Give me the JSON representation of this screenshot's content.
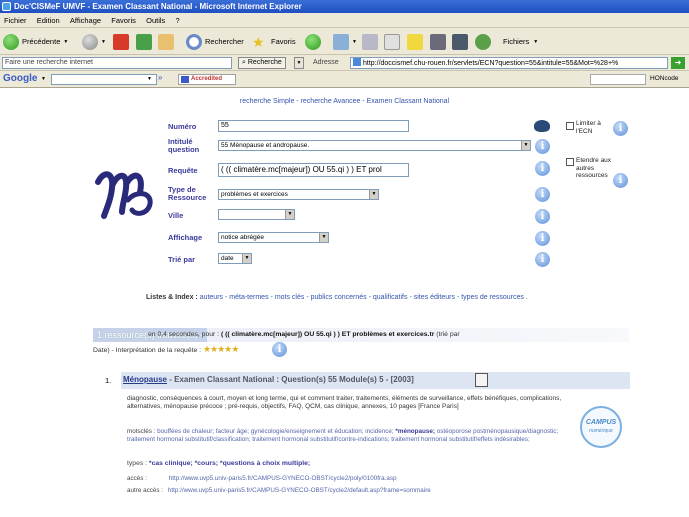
{
  "window": {
    "title": "Doc'CISMeF UMVF - Examen Classant National - Microsoft Internet Explorer"
  },
  "menu": [
    "Fichier",
    "Edition",
    "Affichage",
    "Favoris",
    "Outils",
    "?"
  ],
  "toolbar": {
    "back": "Précédente",
    "search": "Rechercher",
    "favorites": "Favoris",
    "folders": "Fichiers"
  },
  "addressbar": {
    "search_placeholder": "Faire une recherche internet",
    "search_button": "Recherche",
    "address_label": "Adresse",
    "url": "http://doccismef.chu-rouen.fr/servlets/ECN?question=55&intitule=55&Mot=%28+%",
    "hon_label": "HONcode"
  },
  "googlebar": {
    "logo": "Google",
    "accredited": "Accredited"
  },
  "nav": {
    "simple": "recherche Simple",
    "avancee": "recherche Avancee",
    "current": "Examen Classant National"
  },
  "form": {
    "numero_label": "Numéro",
    "numero_value": "55",
    "intitule_label": "Intitulé question",
    "intitule_value": "55 Ménopause et andropause.",
    "requete_label": "Requête",
    "requete_value": "( (( climatère.mc[majeur]) OU 55.qi ) ) ET prol",
    "type_label": "Type de Ressource",
    "type_value": "problèmes et exercices",
    "ville_label": "Ville",
    "ville_value": "",
    "affichage_label": "Affichage",
    "affichage_value": "notice abrégée",
    "trie_label": "Trié par",
    "trie_value": "date",
    "limiter_label": "Limiter à l'ECN",
    "etendre_label": "Etendre aux autres ressources"
  },
  "index": {
    "label": "Listes & Index :",
    "items": [
      "auteurs",
      "méta-termes",
      "mots clés",
      "publics concernés",
      "qualificatifs",
      "sites éditeurs",
      "types de ressources"
    ]
  },
  "results": {
    "found": "1 ressource(s) trouvée(s)",
    "time_text": "en 0,4 secondes, pour :",
    "query_text": "( (( climatère.mc[majeur]) OU 55.qi ) ) ET problèmes et exercices.tr",
    "sort_text": "(trié par",
    "line2": "Date) - Interprétation de la requête :"
  },
  "hit": {
    "num": "1.",
    "title": "Ménopause",
    "title_rest": "- Examen Classant National : Question(s) 55 Module(s) 5 - [2003]",
    "description": "diagnostic, conséquences à court, moyen et long terme, qui et comment traiter, traitements, éléments de surveillance, effets bénéfiques, complications, alternatives, ménopause précoce ; pré-requis, objectifs, FAQ, QCM, cas clinique, annexes, 10 pages [France Paris]",
    "motscles_label": "motsclés :",
    "motscles": "bouffées de chaleur; facteur âge; gynécologie/enseignement et éducation; incidence;",
    "motscles_bold": "*ménopause;",
    "motscles_rest": "ostéoporose postménopausique/diagnostic; traitement hormonal substitutif/classification; traitement hormonal substitutif/contre-indications; traitement hormonal substitutif/effets indésirables;",
    "types_label": "types :",
    "types": "*cas clinique; *cours; *questions à choix multiple;",
    "acces_label": "accès :",
    "acces_url": "http://www.uvp5.univ-paris5.fr/CAMPUS-GYNECO-OBST/cycle2/poly/0100fra.asp",
    "autre_label": "autre accès :",
    "autre_url": "http://www.uvp5.univ-paris5.fr/CAMPUS-GYNECO-OBST/cycle2/default.asp?frame=sommaire",
    "campus": "CAMPUS",
    "campus_sub": "numérique"
  }
}
